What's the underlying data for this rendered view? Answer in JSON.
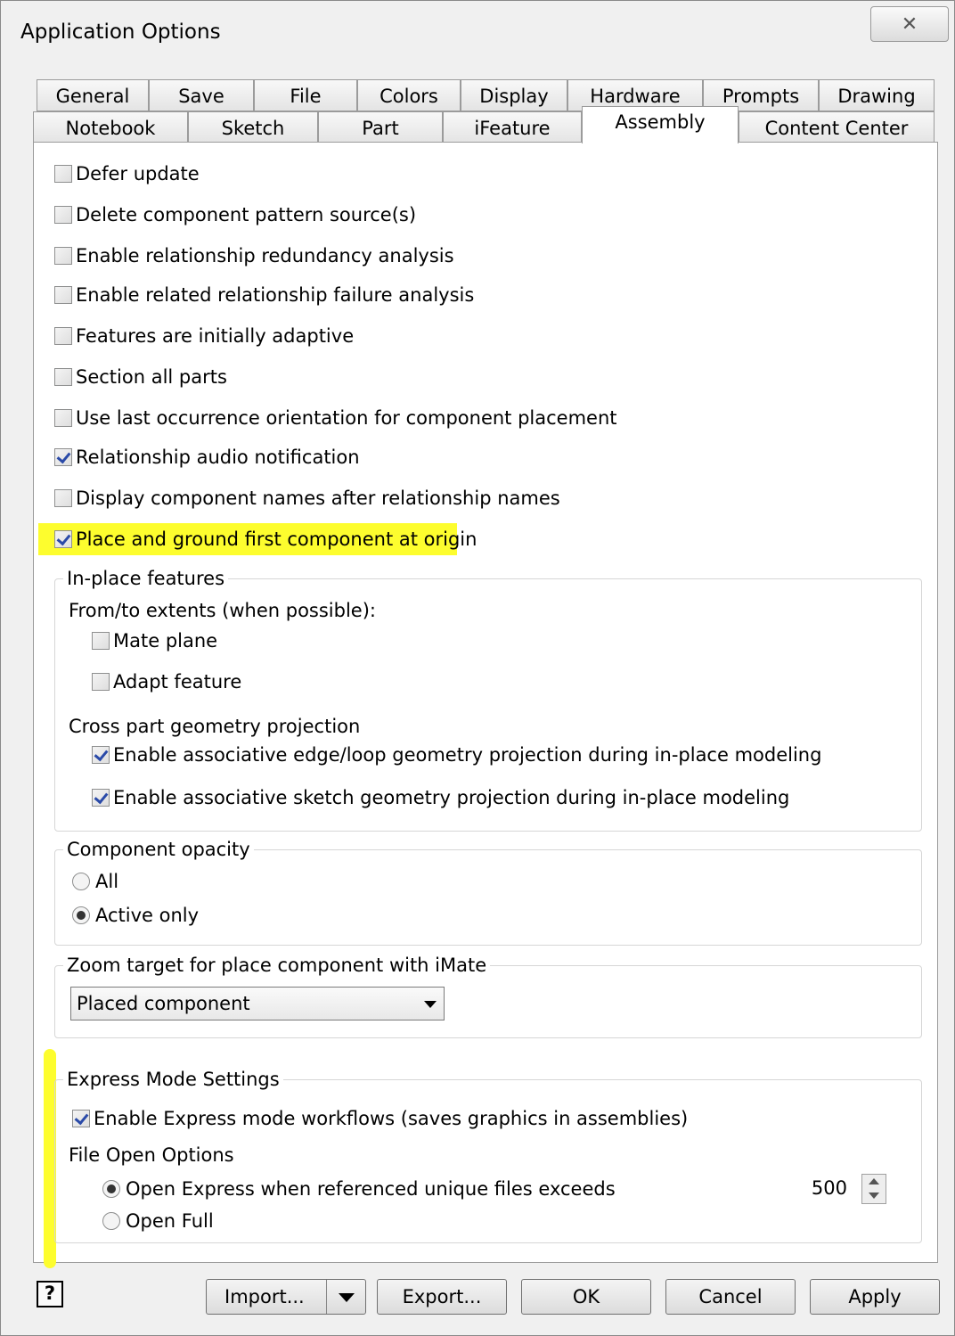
{
  "window": {
    "title": "Application Options",
    "close_glyph": "✕"
  },
  "tabs_top": [
    "General",
    "Save",
    "File",
    "Colors",
    "Display",
    "Hardware",
    "Prompts",
    "Drawing"
  ],
  "tabs_bottom": [
    "Notebook",
    "Sketch",
    "Part",
    "iFeature",
    "Assembly",
    "Content Center"
  ],
  "active_tab": "Assembly",
  "options": [
    {
      "label": "Defer update",
      "checked": false
    },
    {
      "label": "Delete component pattern source(s)",
      "checked": false
    },
    {
      "label": "Enable relationship redundancy analysis",
      "checked": false
    },
    {
      "label": "Enable related relationship failure analysis",
      "checked": false
    },
    {
      "label": "Features are initially adaptive",
      "checked": false
    },
    {
      "label": "Section all parts",
      "checked": false
    },
    {
      "label": "Use last occurrence orientation for component placement",
      "checked": false
    },
    {
      "label": "Relationship audio notification",
      "checked": true
    },
    {
      "label": "Display component names after relationship names",
      "checked": false
    },
    {
      "label": "Place and ground first component at origin",
      "checked": true
    }
  ],
  "inplace": {
    "title": "In-place features",
    "extents_label": "From/to extents (when possible):",
    "mate_plane": {
      "label": "Mate plane",
      "checked": false
    },
    "adapt_feature": {
      "label": "Adapt feature",
      "checked": false
    },
    "projection_label": "Cross part geometry projection",
    "edge_loop": {
      "label": "Enable associative edge/loop geometry projection during in-place modeling",
      "checked": true
    },
    "sketch_geom": {
      "label": "Enable associative sketch geometry projection during in-place modeling",
      "checked": true
    }
  },
  "opacity": {
    "title": "Component opacity",
    "all": {
      "label": "All",
      "selected": false
    },
    "active_only": {
      "label": "Active only",
      "selected": true
    }
  },
  "zoom": {
    "title": "Zoom target for place component with iMate",
    "selected": "Placed component"
  },
  "express": {
    "title": "Express Mode Settings",
    "enable": {
      "label": "Enable Express mode workflows (saves graphics in assemblies)",
      "checked": true
    },
    "file_open_label": "File Open Options",
    "open_express": {
      "label": "Open Express when referenced unique files exceeds",
      "selected": true
    },
    "threshold": "500",
    "open_full": {
      "label": "Open Full",
      "selected": false
    }
  },
  "footer": {
    "help_glyph": "?",
    "import_label": "Import...",
    "export_label": "Export...",
    "ok_label": "OK",
    "cancel_label": "Cancel",
    "apply_label": "Apply"
  },
  "highlight_color": "#fdfd2e"
}
